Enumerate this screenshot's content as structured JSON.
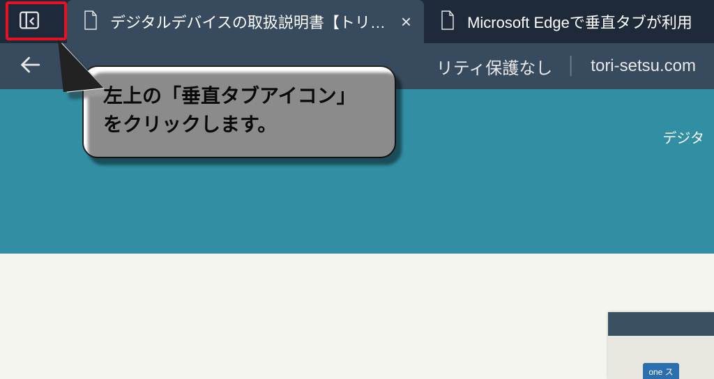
{
  "tabs": [
    {
      "title": "デジタルデバイスの取扱説明書【トリ…",
      "active": true
    },
    {
      "title": "Microsoft Edgeで垂直タブが利用",
      "active": false
    }
  ],
  "addressbar": {
    "security_label": "リティ保護なし",
    "domain": "tori-setsu.com"
  },
  "hero": {
    "label_fragment": "デジタ"
  },
  "thumb": {
    "badge": "one ス"
  },
  "callout": {
    "line1": "左上の「垂直タブアイコン」",
    "line2": "をクリックします。"
  },
  "icons": {
    "vertical_tabs": "vertical-tabs-icon",
    "file": "file-icon",
    "close": "close-icon",
    "back": "back-arrow-icon"
  }
}
